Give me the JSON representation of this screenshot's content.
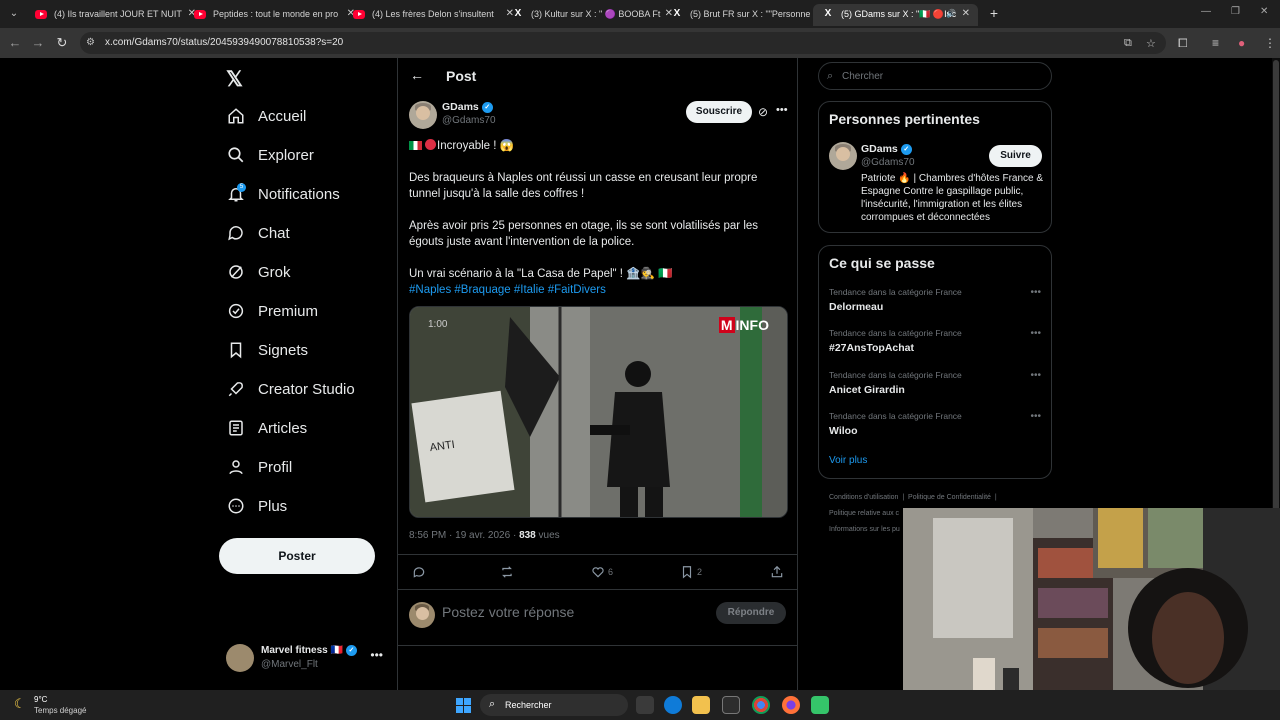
{
  "browser": {
    "tabs": [
      {
        "title": "(4) Ils travaillent JOUR ET NUIT",
        "favicon": "youtube-icon"
      },
      {
        "title": "Peptides : tout le monde en pro",
        "favicon": "youtube-icon"
      },
      {
        "title": "(4) Les frères Delon s'insultent",
        "favicon": "youtube-icon"
      },
      {
        "title": "(3) Kultur sur X : \" 🟣 BOOBA Ft",
        "favicon": "x-icon"
      },
      {
        "title": "(5) Brut FR sur X : \"\"Personne n",
        "favicon": "x-icon"
      },
      {
        "title": "(5) GDams sur X : \"🇮🇹 🔴Inc",
        "favicon": "x-icon",
        "active": true
      }
    ],
    "url": "x.com/Gdams70/status/2045939490078810538?s=20"
  },
  "x": {
    "logo": "𝕏",
    "nav": [
      {
        "label": "Accueil",
        "icon": "home-icon"
      },
      {
        "label": "Explorer",
        "icon": "search-icon"
      },
      {
        "label": "Notifications",
        "icon": "bell-icon",
        "badge": "5"
      },
      {
        "label": "Chat",
        "icon": "chat-icon"
      },
      {
        "label": "Grok",
        "icon": "grok-icon"
      },
      {
        "label": "Premium",
        "icon": "premium-icon"
      },
      {
        "label": "Signets",
        "icon": "bookmark-icon"
      },
      {
        "label": "Creator Studio",
        "icon": "rocket-icon"
      },
      {
        "label": "Articles",
        "icon": "article-icon"
      },
      {
        "label": "Profil",
        "icon": "profile-icon"
      },
      {
        "label": "Plus",
        "icon": "more-circle-icon"
      }
    ],
    "post_button": "Poster",
    "account": {
      "name": "Marvel fitness 🇫🇷",
      "handle": "@Marvel_Flt"
    },
    "post": {
      "header_title": "Post",
      "author_name": "GDams",
      "author_handle": "@Gdams70",
      "subscribe_label": "Souscrire",
      "line1": "Incroyable ! 😱",
      "para1": "Des braqueurs à Naples ont réussi un casse en creusant leur propre tunnel jusqu'à la salle des coffres !",
      "para2": "Après avoir pris 25 personnes en otage, ils se sont volatilisés par les égouts juste avant l'intervention de la police.",
      "para3": "Un vrai scénario à la \"La Casa de Papel\" ! 🏦🕵️ 🇮🇹",
      "hashtags": "#Naples #Braquage #Italie #FaitDivers",
      "media_time": "1:00",
      "media_logo_m": "M",
      "media_logo_text": "INFO",
      "timestamp": "8:56 PM · 19 avr. 2026 · ",
      "views_count": "838",
      "views_label": " vues",
      "likes": "6",
      "bookmarks": "2",
      "reply_placeholder": "Postez votre réponse",
      "reply_button": "Répondre"
    },
    "search_placeholder": "Chercher",
    "relevant": {
      "title": "Personnes pertinentes",
      "name": "GDams",
      "handle": "@Gdams70",
      "follow_label": "Suivre",
      "bio": "Patriote 🔥 | Chambres d'hôtes France & Espagne Contre le gaspillage public, l'insécurité, l'immigration et les élites corrompues et déconnectées"
    },
    "trends": {
      "title": "Ce qui se passe",
      "items": [
        {
          "category": "Tendance dans la catégorie France",
          "topic": "Delormeau"
        },
        {
          "category": "Tendance dans la catégorie France",
          "topic": "#27AnsTopAchat"
        },
        {
          "category": "Tendance dans la catégorie France",
          "topic": "Anicet Girardin"
        },
        {
          "category": "Tendance dans la catégorie France",
          "topic": "Wiloo"
        }
      ],
      "see_more": "Voir plus"
    },
    "footer": {
      "terms": "Conditions d'utilisation",
      "privacy": "Politique de Confidentialité",
      "cookies": "Politique relative aux c",
      "info": "Informations sur les pu"
    }
  },
  "taskbar": {
    "temp": "9°C",
    "weather": "Temps dégagé",
    "search": "Rechercher"
  },
  "colors": {
    "accent": "#1d9bf0",
    "background": "#000000",
    "border": "#2f3336"
  }
}
